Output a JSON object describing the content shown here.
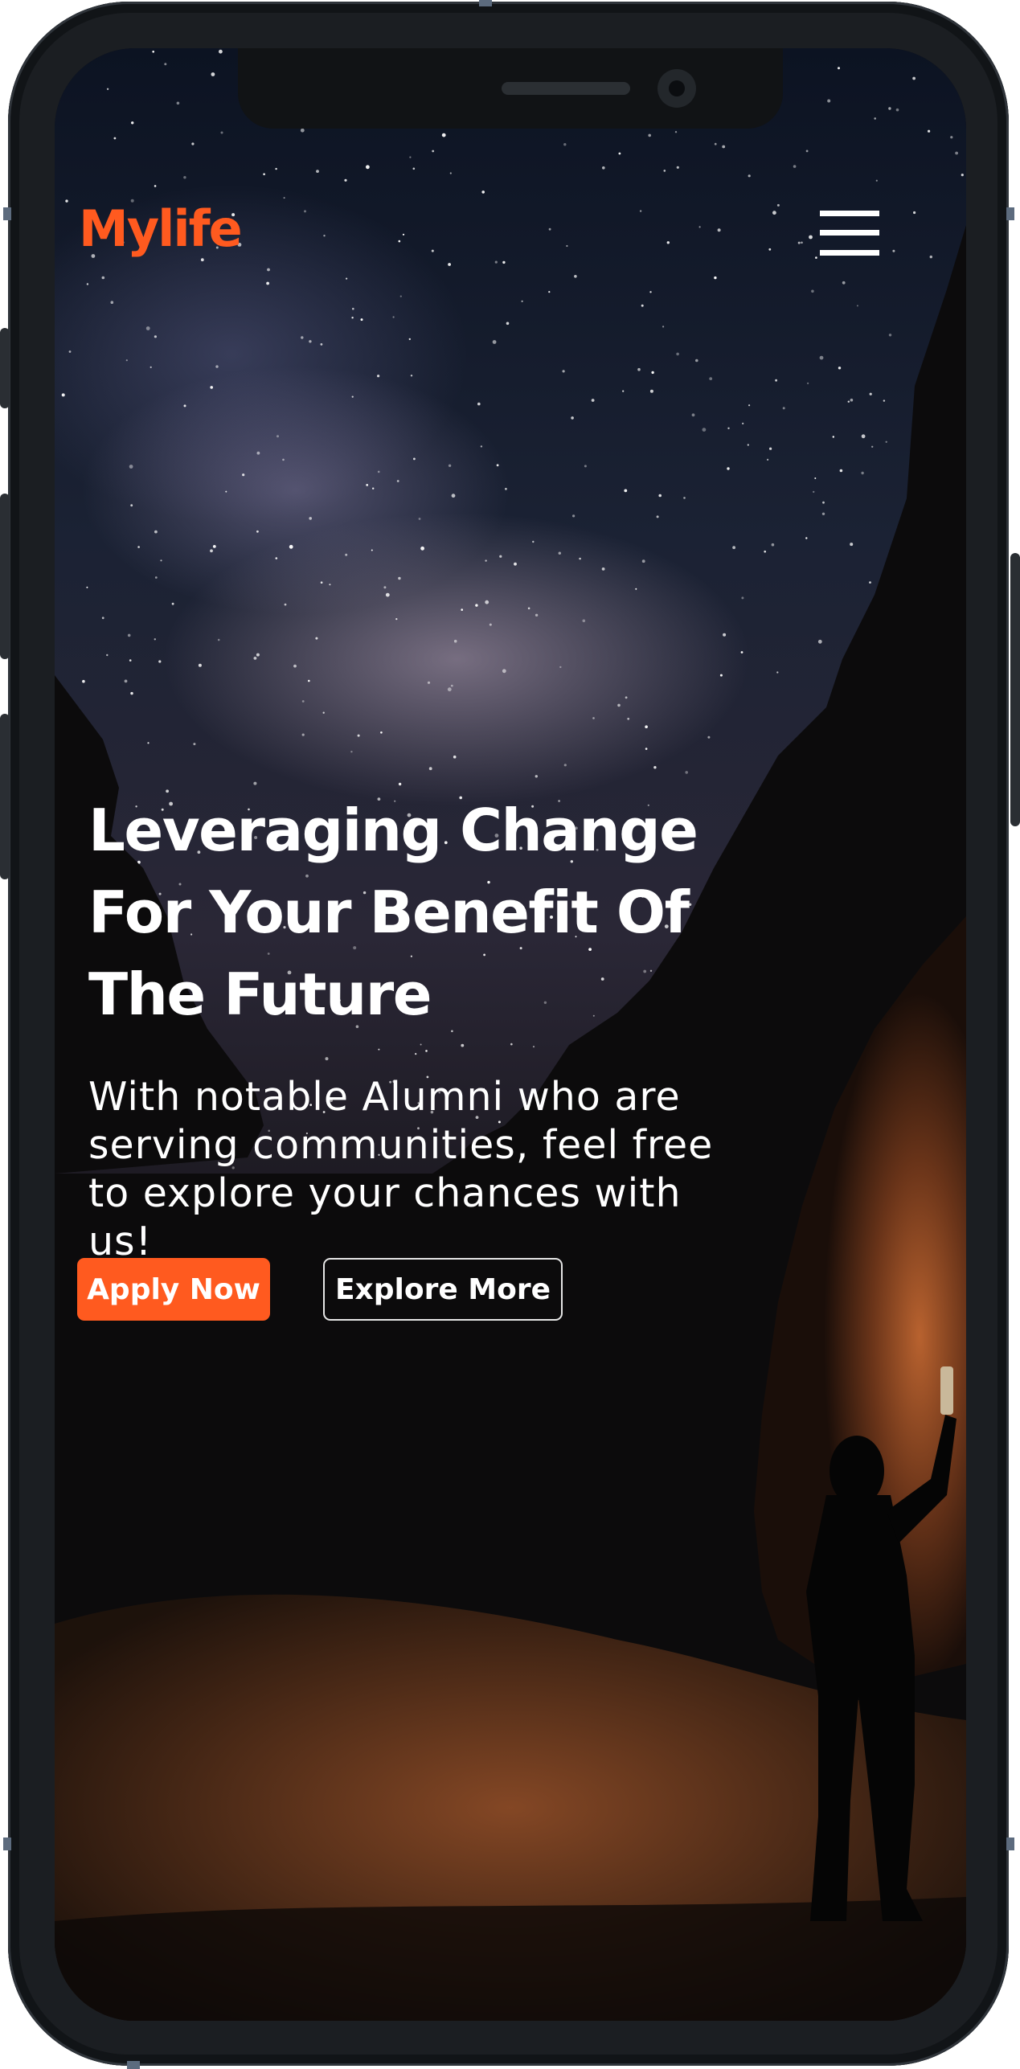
{
  "app": {
    "logo": "Mylife",
    "menu_icon": "hamburger-menu-icon"
  },
  "hero": {
    "headline_lines": [
      "Leveraging Change",
      "For Your Benefit Of",
      "The Future"
    ],
    "subtext": "With notable Alumni who are serving communities, feel free to explore your chances with us!",
    "primary_button": "Apply Now",
    "secondary_button": "Explore More"
  },
  "colors": {
    "accent": "#ff5a1f",
    "text": "#ffffff",
    "background": "#0b0b0d"
  }
}
